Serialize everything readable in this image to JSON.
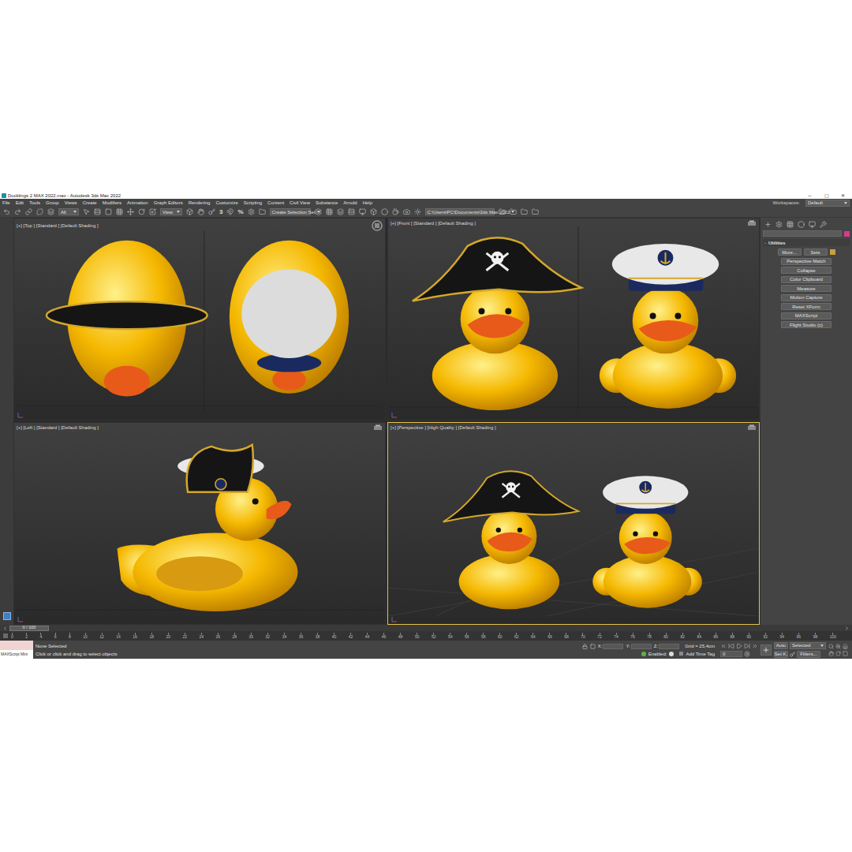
{
  "window": {
    "title": "Ducklings 2 MAX 2022.max - Autodesk 3ds Max 2022",
    "controls": [
      "─",
      "▢",
      "✕"
    ]
  },
  "menu": [
    "File",
    "Edit",
    "Tools",
    "Group",
    "Views",
    "Create",
    "Modifiers",
    "Animation",
    "Graph Editors",
    "Rendering",
    "Customize",
    "Scripting",
    "Content",
    "Civil View",
    "Substance",
    "Arnold",
    "Help"
  ],
  "workspace": {
    "label": "Workspaces:",
    "value": "Default"
  },
  "toolbar": {
    "filter": "All",
    "coord": "View",
    "snap": "3",
    "percent": "%",
    "selection_set": "Create Selection Set",
    "project_path": "C:\\Users\\PC\\Documents\\3ds Max 2022"
  },
  "viewports": [
    {
      "label": "[+] [Top ] [Standard ] [Default Shading ]",
      "kind": "top",
      "active": false
    },
    {
      "label": "[+] [Front ] [Standard ] [Default Shading ]",
      "kind": "front",
      "active": false
    },
    {
      "label": "[+] [Left ] [Standard ] [Default Shading ]",
      "kind": "left",
      "active": false
    },
    {
      "label": "[+] [Perspective ] [High Quality ] [Default Shading ]",
      "kind": "perspective",
      "active": true
    }
  ],
  "command_panel": {
    "rollout": "Utilities",
    "rollout_toggle": "-",
    "button_pair": [
      "More...",
      "Sets"
    ],
    "buttons": [
      "Perspective Match",
      "Collapse",
      "Color Clipboard",
      "Measure",
      "Motion Capture",
      "Reset XForm",
      "MAXScript",
      "Flight Studio (c)"
    ]
  },
  "timeline": {
    "frame": "0 / 100",
    "level": 0,
    "ticks": [
      "0",
      "2",
      "4",
      "6",
      "8",
      "10",
      "12",
      "14",
      "16",
      "18",
      "20",
      "22",
      "24",
      "26",
      "28",
      "30",
      "32",
      "34",
      "36",
      "38",
      "40",
      "42",
      "44",
      "46",
      "48",
      "50",
      "52",
      "54",
      "56",
      "58",
      "60",
      "62",
      "64",
      "66",
      "68",
      "70",
      "72",
      "74",
      "76",
      "78",
      "80",
      "82",
      "84",
      "86",
      "88",
      "90",
      "92",
      "94",
      "96",
      "98",
      "100"
    ]
  },
  "status": {
    "listener": "MAXScript Mini",
    "selection": "None Selected",
    "prompt": "Click or click and drag to select objects",
    "coords": [
      "X:",
      "Y:",
      "Z:"
    ],
    "grid": "Grid = 25,4cm",
    "enabled": "Enabled:",
    "time_tag": "Add Time Tag",
    "key_mode": "Auto",
    "key_filter": "Selected",
    "set_key": "Set K.",
    "filters": "Filters...",
    "frame": "0"
  }
}
